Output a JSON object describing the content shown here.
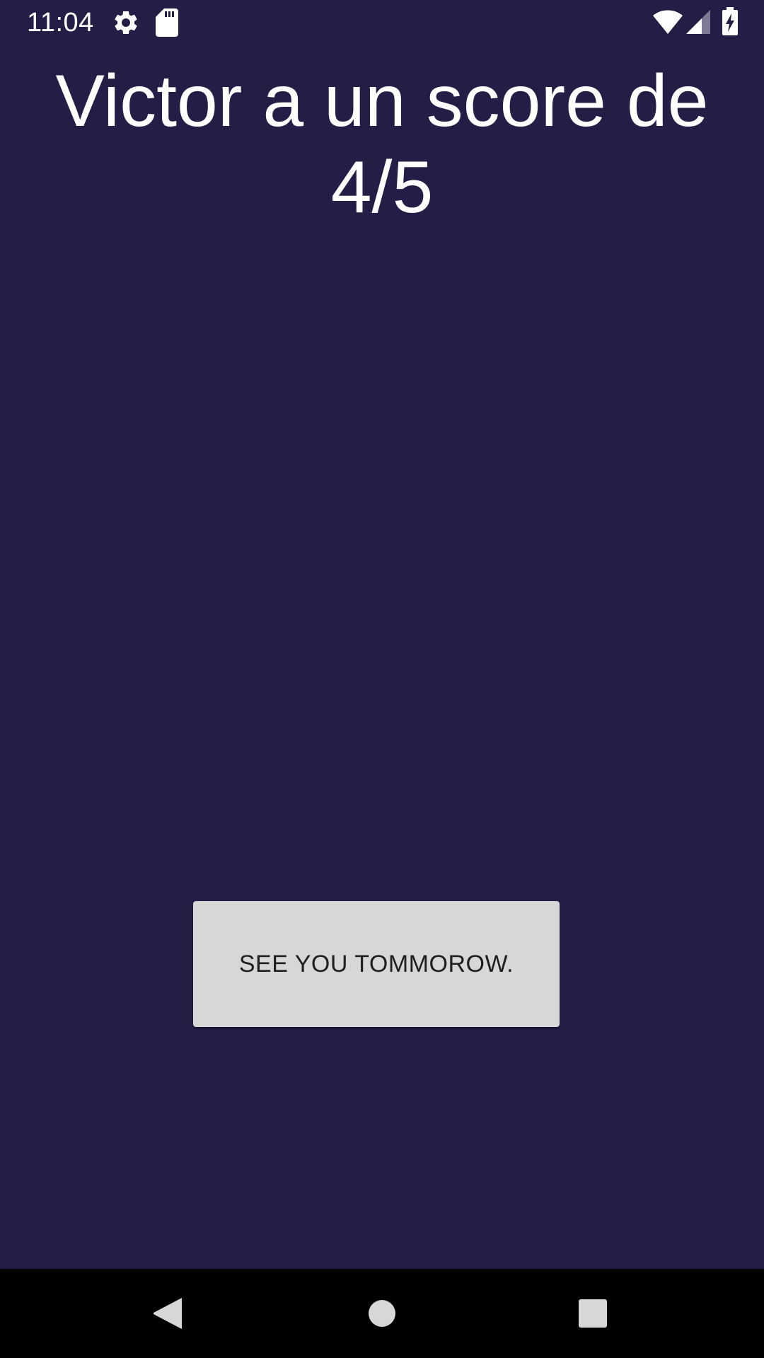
{
  "status_bar": {
    "time": "11:04",
    "icons": [
      "gear-icon",
      "sd-card-icon",
      "wifi-icon",
      "signal-icon",
      "battery-charging-icon"
    ]
  },
  "main": {
    "title": "Victor a un score de 4/5",
    "button_label": "SEE YOU TOMMOROW."
  },
  "nav_bar": {
    "buttons": [
      "back",
      "home",
      "recents"
    ]
  },
  "colors": {
    "background": "#221e45",
    "button_bg": "#d6d7d7",
    "text": "#ffffff",
    "nav_bg": "#000000"
  }
}
